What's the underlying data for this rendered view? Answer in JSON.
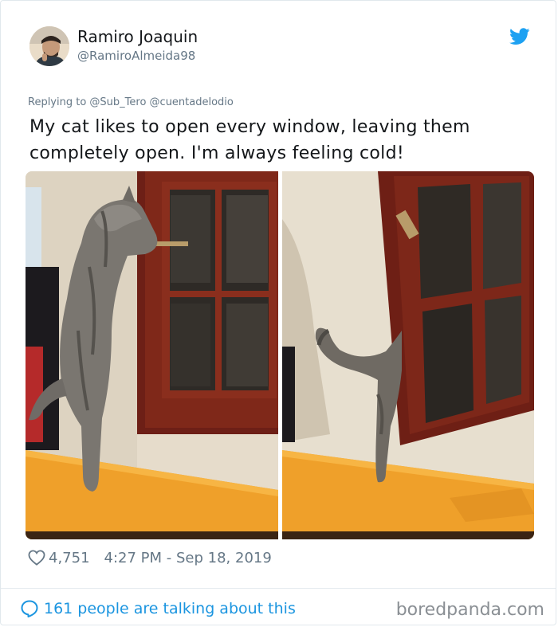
{
  "author": {
    "display_name": "Ramiro Joaquin",
    "handle": "@RamiroAlmeida98"
  },
  "reply_line": "Replying to @Sub_Tero @cuentadelodio",
  "tweet_text": "My cat likes to open every window, leaving them completely open. I'm always feeling cold!",
  "likes": "4,751",
  "timestamp": "4:27 PM - Sep 18, 2019",
  "talking_text": "161 people are talking about this",
  "watermark": "boredpanda.com",
  "icons": {
    "brand": "twitter-bird-icon",
    "like": "heart-outline-icon",
    "conversation": "speech-bubble-icon"
  },
  "colors": {
    "twitter_blue": "#1da1f2",
    "link_blue": "#1b95e0",
    "secondary_text": "#657786",
    "window_frame": "#7a2318",
    "wall": "#e8dfd0",
    "table": "#f2a12a"
  }
}
